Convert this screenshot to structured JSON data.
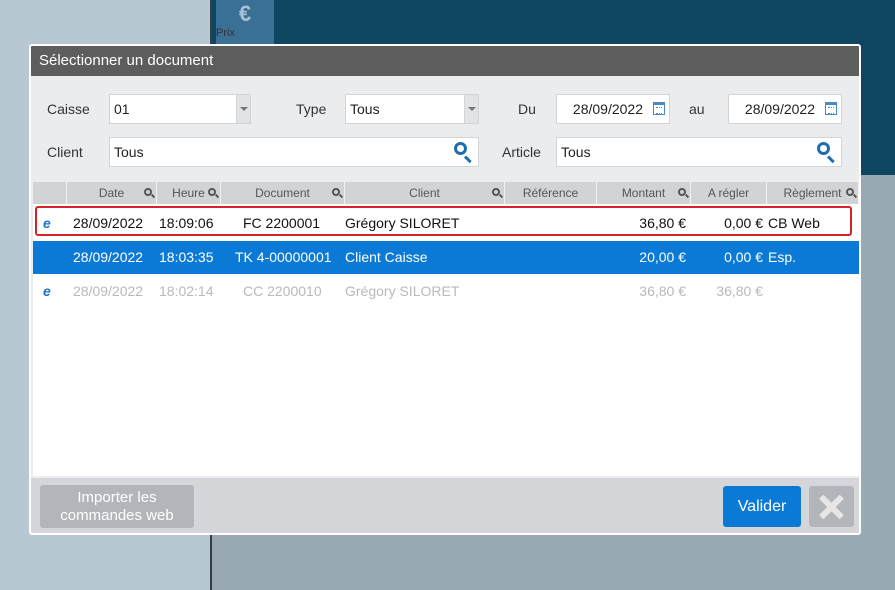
{
  "background": {
    "prix_button": {
      "icon": "euro-icon",
      "symbol": "€",
      "label": "Prix"
    }
  },
  "dialog": {
    "title": "Sélectionner un document",
    "filters": {
      "caisse": {
        "label": "Caisse",
        "value": "01"
      },
      "type": {
        "label": "Type",
        "value": "Tous"
      },
      "du": {
        "label": "Du",
        "value": "28/09/2022"
      },
      "au": {
        "label": "au",
        "value": "28/09/2022"
      },
      "client": {
        "label": "Client",
        "value": "Tous"
      },
      "article": {
        "label": "Article",
        "value": "Tous"
      }
    },
    "table": {
      "columns": [
        "Date",
        "Heure",
        "Document",
        "Client",
        "Référence",
        "Montant",
        "A régler",
        "Règlement"
      ],
      "rows": [
        {
          "icon": "e",
          "date": "28/09/2022",
          "heure": "18:09:06",
          "document": "FC 2200001",
          "client": "Grégory SILORET",
          "reference": "",
          "montant": "36,80 €",
          "a_regler": "0,00 €",
          "reglement": "CB Web"
        },
        {
          "icon": "",
          "date": "28/09/2022",
          "heure": "18:03:35",
          "document": "TK 4-00000001",
          "client": "Client Caisse",
          "reference": "",
          "montant": "20,00 €",
          "a_regler": "0,00 €",
          "reglement": "Esp."
        },
        {
          "icon": "e",
          "date": "28/09/2022",
          "heure": "18:02:14",
          "document": "CC 2200010",
          "client": "Grégory SILORET",
          "reference": "",
          "montant": "36,80 €",
          "a_regler": "36,80 €",
          "reglement": ""
        }
      ]
    },
    "footer": {
      "import_line1": "Importer les",
      "import_line2": "commandes web",
      "validate": "Valider"
    }
  },
  "colors": {
    "accent": "#0a7ad6",
    "title_bar": "#5d5d5d",
    "highlight_border": "#d8222a"
  }
}
